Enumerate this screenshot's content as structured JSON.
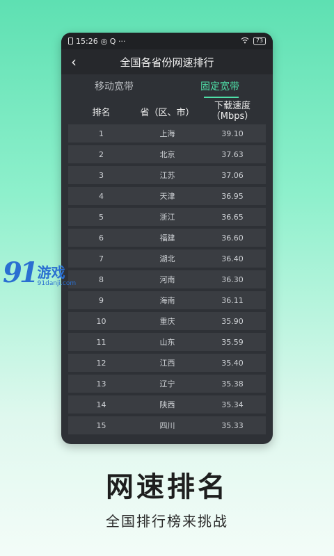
{
  "status": {
    "time": "15:26",
    "notif": "◎ Q ···",
    "battery": "73"
  },
  "header": {
    "title": "全国各省份网速排行"
  },
  "tabs": [
    {
      "label": "移动宽带"
    },
    {
      "label": "固定宽带"
    }
  ],
  "table": {
    "col_rank": "排名",
    "col_region": "省（区、市）",
    "col_speed_l1": "下载速度",
    "col_speed_l2": "（Mbps）",
    "rows": [
      {
        "rank": "1",
        "region": "上海",
        "speed": "39.10"
      },
      {
        "rank": "2",
        "region": "北京",
        "speed": "37.63"
      },
      {
        "rank": "3",
        "region": "江苏",
        "speed": "37.06"
      },
      {
        "rank": "4",
        "region": "天津",
        "speed": "36.95"
      },
      {
        "rank": "5",
        "region": "浙江",
        "speed": "36.65"
      },
      {
        "rank": "6",
        "region": "福建",
        "speed": "36.60"
      },
      {
        "rank": "7",
        "region": "湖北",
        "speed": "36.40"
      },
      {
        "rank": "8",
        "region": "河南",
        "speed": "36.30"
      },
      {
        "rank": "9",
        "region": "海南",
        "speed": "36.11"
      },
      {
        "rank": "10",
        "region": "重庆",
        "speed": "35.90"
      },
      {
        "rank": "11",
        "region": "山东",
        "speed": "35.59"
      },
      {
        "rank": "12",
        "region": "江西",
        "speed": "35.40"
      },
      {
        "rank": "13",
        "region": "辽宁",
        "speed": "35.38"
      },
      {
        "rank": "14",
        "region": "陕西",
        "speed": "35.34"
      },
      {
        "rank": "15",
        "region": "四川",
        "speed": "35.33"
      }
    ]
  },
  "watermark": {
    "logo": "91",
    "text": "游戏",
    "url": "91danji.com"
  },
  "promo": {
    "heading": "网速排名",
    "subheading": "全国排行榜来挑战"
  }
}
